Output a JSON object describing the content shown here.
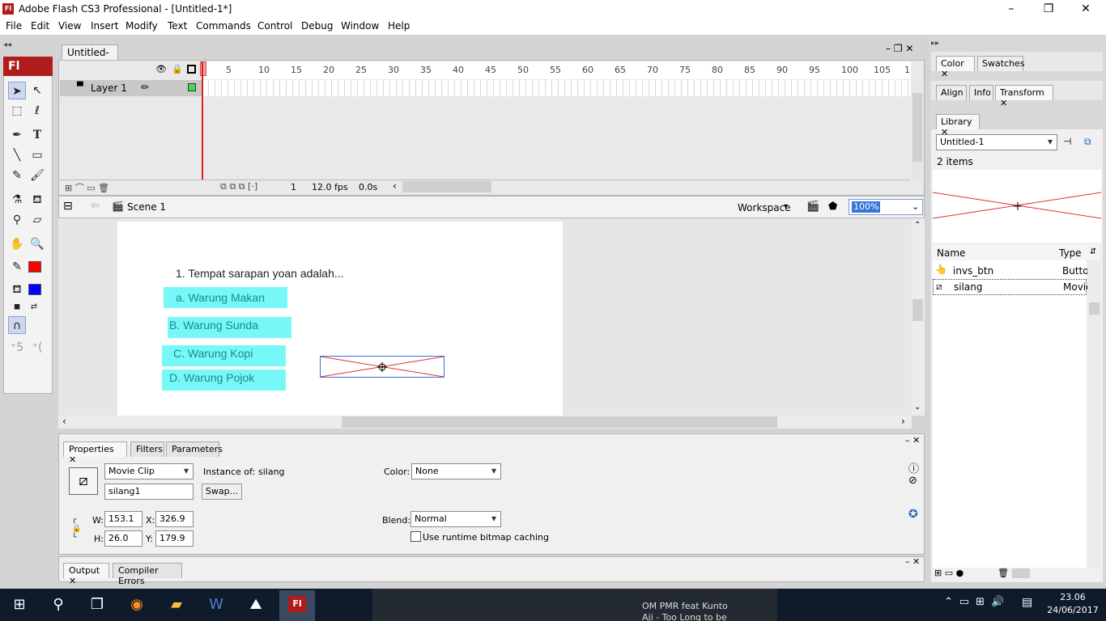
{
  "window": {
    "title": "Adobe Flash CS3 Professional - [Untitled-1*]",
    "logo": "Fl"
  },
  "menu": [
    "File",
    "Edit",
    "View",
    "Insert",
    "Modify",
    "Text",
    "Commands",
    "Control",
    "Debug",
    "Window",
    "Help"
  ],
  "tools": {
    "badge": "Fl"
  },
  "document": {
    "tab": "Untitled-1*"
  },
  "timeline": {
    "ruler": [
      "5",
      "10",
      "15",
      "20",
      "25",
      "30",
      "35",
      "40",
      "45",
      "50",
      "55",
      "60",
      "65",
      "70",
      "75",
      "80",
      "85",
      "90",
      "95",
      "100",
      "105",
      "1"
    ],
    "layer": "Layer 1",
    "frame": "1",
    "fps": "12.0 fps",
    "time": "0.0s"
  },
  "editbar": {
    "scene": "Scene 1",
    "workspace": "Workspace",
    "zoom": "100%"
  },
  "stage": {
    "question": "1. Tempat sarapan yoan adalah...",
    "answers": [
      "a. Warung Makan",
      "B. Warung Sunda",
      "C. Warung Kopi",
      "D. Warung Pojok"
    ]
  },
  "properties": {
    "tabs": [
      "Properties",
      "Filters",
      "Parameters"
    ],
    "type": "Movie Clip",
    "instance_label": "Instance of:",
    "instance_of": "silang",
    "instance_name": "silang1",
    "swap": "Swap...",
    "color_label": "Color:",
    "color": "None",
    "blend_label": "Blend:",
    "blend": "Normal",
    "bitmap_caching": "Use runtime bitmap caching",
    "w_label": "W:",
    "w": "153.1",
    "x_label": "X:",
    "x": "326.9",
    "h_label": "H:",
    "h": "26.0",
    "y_label": "Y:",
    "y": "179.9"
  },
  "output": {
    "tabs": [
      "Output",
      "Compiler Errors"
    ]
  },
  "right_panel": {
    "color_tabs": [
      "Color",
      "Swatches"
    ],
    "align_tabs": [
      "Align",
      "Info",
      "Transform"
    ],
    "library_tab": "Library",
    "library_doc": "Untitled-1",
    "item_count": "2 items",
    "columns": [
      "Name",
      "Type"
    ],
    "items": [
      {
        "name": "invs_btn",
        "type": "Butto"
      },
      {
        "name": "silang",
        "type": "Movie"
      }
    ]
  },
  "taskbar": {
    "time": "23.06",
    "date": "24/06/2017",
    "bg_text": "OM PMR feat Kunto",
    "bg_text2": "Aji - Too Long to be"
  },
  "colors": {
    "stroke": "#ff0000",
    "fill": "#0000ff",
    "answer_bg": "#76f8f8",
    "answer_text": "#1b8a8a",
    "accent": "#b01c1c"
  }
}
